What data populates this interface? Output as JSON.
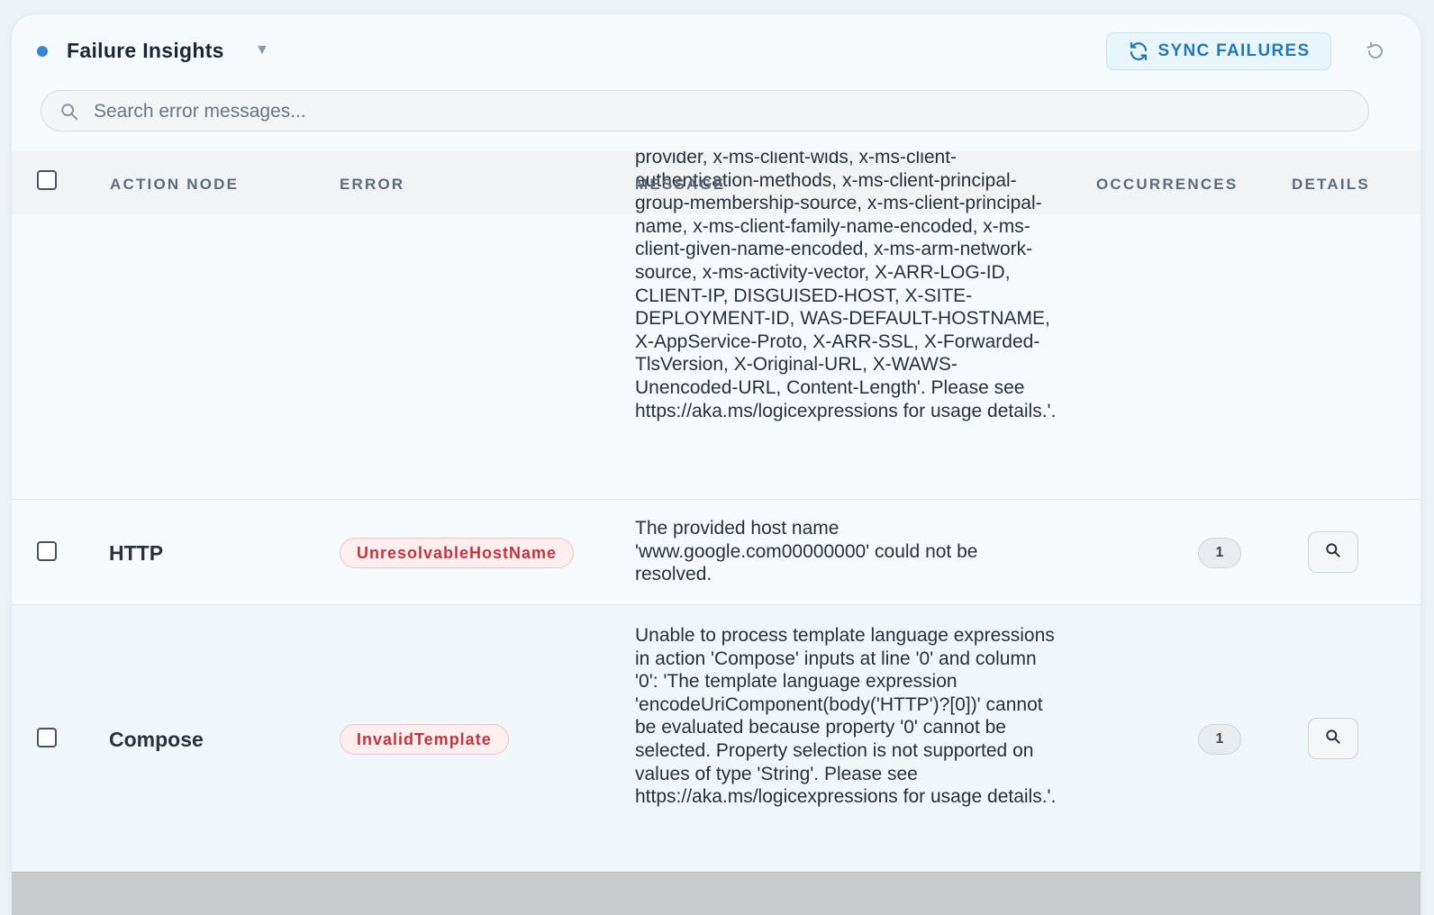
{
  "header": {
    "title": "Failure Insights",
    "sync_label": "SYNC FAILURES",
    "status_color": "#3a85d0"
  },
  "search": {
    "placeholder": "Search error messages..."
  },
  "table": {
    "columns": {
      "action_node": "ACTION NODE",
      "error": "ERROR",
      "message": "MESSAGE",
      "occurrences": "OCCURRENCES",
      "details": "DETAILS"
    },
    "partial_row": {
      "message": "provider, x-ms-client-wids, x-ms-client-authentication-methods, x-ms-client-principal-group-membership-source, x-ms-client-principal-name, x-ms-client-family-name-encoded, x-ms-client-given-name-encoded, x-ms-arm-network-source, x-ms-activity-vector, X-ARR-LOG-ID, CLIENT-IP, DISGUISED-HOST, X-SITE-DEPLOYMENT-ID, WAS-DEFAULT-HOSTNAME, X-AppService-Proto, X-ARR-SSL, X-Forwarded-TlsVersion, X-Original-URL, X-WAWS-Unencoded-URL, Content-Length'. Please see https://aka.ms/logicexpressions for usage details.'."
    },
    "rows": [
      {
        "node": "HTTP",
        "error": "UnresolvableHostName",
        "message": "The provided host name 'www.google.com00000000' could not be resolved.",
        "occurrences": "1"
      },
      {
        "node": "Compose",
        "error": "InvalidTemplate",
        "message": "Unable to process template language expressions in action 'Compose' inputs at line '0' and column '0': 'The template language expression 'encodeUriComponent(body('HTTP')?[0])' cannot be evaluated because property '0' cannot be selected. Property selection is not supported on values of type 'String'. Please see https://aka.ms/logicexpressions for usage details.'.",
        "occurrences": "1"
      }
    ]
  },
  "icons": {
    "sync": "refresh-icon",
    "reset": "undo-icon",
    "search": "search-icon",
    "details": "magnifier-icon"
  }
}
